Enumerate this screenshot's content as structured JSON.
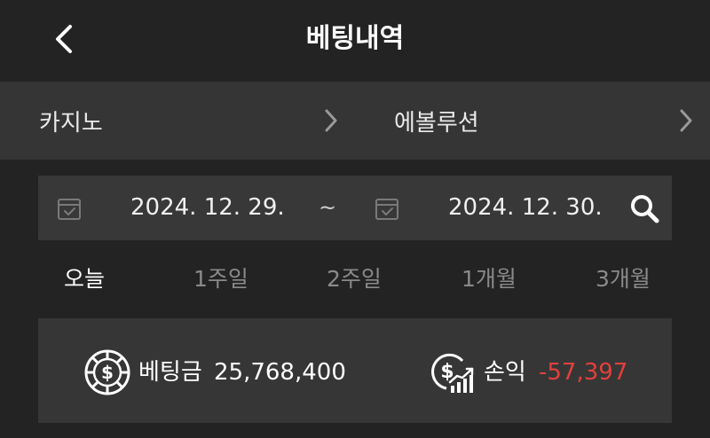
{
  "header": {
    "title": "베팅내역"
  },
  "filters": {
    "category": "카지노",
    "provider": "에볼루션"
  },
  "date_range": {
    "start": "2024. 12. 29.",
    "separator": "~",
    "end": "2024. 12. 30."
  },
  "periods": [
    {
      "label": "오늘",
      "active": true
    },
    {
      "label": "1주일",
      "active": false
    },
    {
      "label": "2주일",
      "active": false
    },
    {
      "label": "1개월",
      "active": false
    },
    {
      "label": "3개월",
      "active": false
    }
  ],
  "summary": {
    "bet_label": "베팅금",
    "bet_value": "25,768,400",
    "pl_label": "손익",
    "pl_value": "-57,397"
  },
  "colors": {
    "background": "#232323",
    "panel": "#353535",
    "negative": "#e2403b",
    "inactive": "#8a8a8a"
  }
}
